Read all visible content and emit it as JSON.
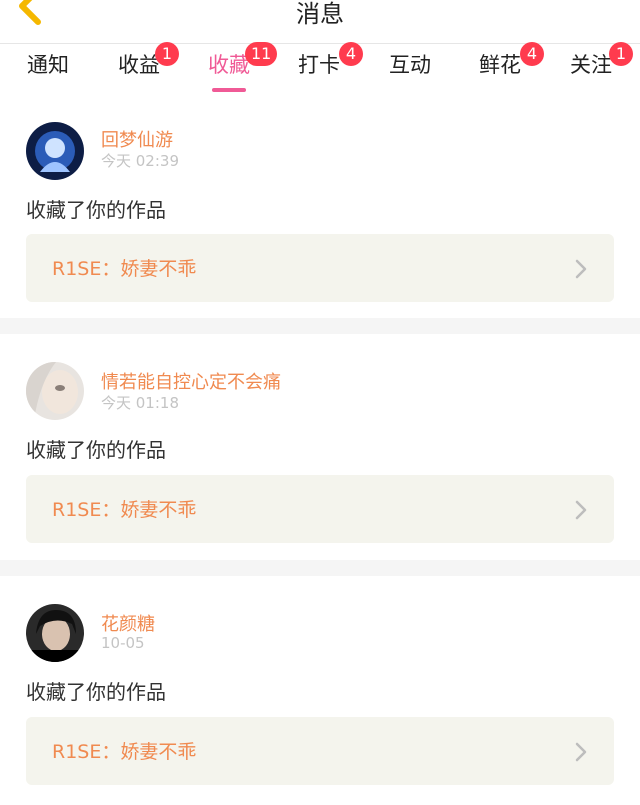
{
  "header": {
    "title": "消息"
  },
  "tabs": [
    {
      "label": "通知",
      "badge": ""
    },
    {
      "label": "收益",
      "badge": "1"
    },
    {
      "label": "收藏",
      "badge": "11",
      "active": true
    },
    {
      "label": "打卡",
      "badge": "4"
    },
    {
      "label": "互动",
      "badge": ""
    },
    {
      "label": "鲜花",
      "badge": "4"
    },
    {
      "label": "关注",
      "badge": "1"
    }
  ],
  "colors": {
    "accent": "#f05a96",
    "badge": "#ff3b4e",
    "name": "#f08a50",
    "card_bg": "#f4f4ed"
  },
  "messages": [
    {
      "username": "回梦仙游",
      "time": "今天 02:39",
      "action": "收藏了你的作品",
      "work_title": "R1SE：娇妻不乖"
    },
    {
      "username": "情若能自控心定不会痛",
      "time": "今天 01:18",
      "action": "收藏了你的作品",
      "work_title": "R1SE：娇妻不乖"
    },
    {
      "username": "花颜糖",
      "time": "10-05",
      "action": "收藏了你的作品",
      "work_title": "R1SE：娇妻不乖"
    }
  ]
}
